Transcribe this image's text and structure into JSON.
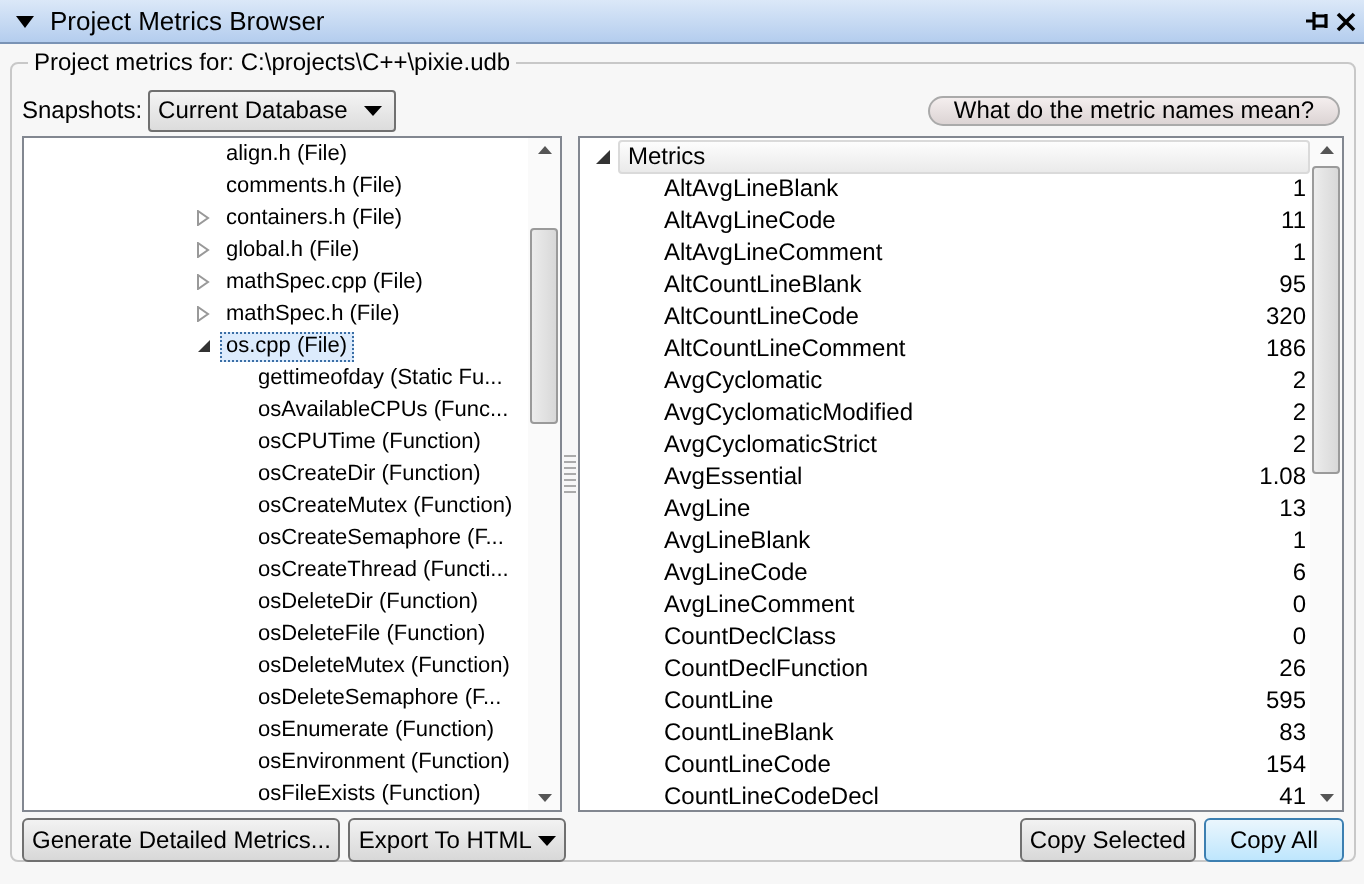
{
  "window": {
    "title": "Project Metrics Browser"
  },
  "group": {
    "label": "Project metrics for: C:\\projects\\C++\\pixie.udb"
  },
  "snapshots": {
    "label": "Snapshots:",
    "value": "Current Database"
  },
  "help_button": "What do the metric names mean?",
  "tree": [
    {
      "label": "align.h (File)",
      "selected": false
    },
    {
      "label": "comments.h (File)",
      "selected": false
    },
    {
      "label": "containers.h (File)",
      "selected": false,
      "expanded": false
    },
    {
      "label": "global.h (File)",
      "selected": false,
      "expanded": false
    },
    {
      "label": "mathSpec.cpp (File)",
      "selected": false,
      "expanded": false
    },
    {
      "label": "mathSpec.h (File)",
      "selected": false,
      "expanded": false
    },
    {
      "label": "os.cpp (File)",
      "selected": true,
      "expanded": true,
      "children": [
        {
          "label": "gettimeofday (Static Fu...",
          "selected": false
        },
        {
          "label": "osAvailableCPUs (Func...",
          "selected": false
        },
        {
          "label": "osCPUTime (Function)",
          "selected": false
        },
        {
          "label": "osCreateDir (Function)",
          "selected": false
        },
        {
          "label": "osCreateMutex (Function)",
          "selected": false
        },
        {
          "label": "osCreateSemaphore (F...",
          "selected": false
        },
        {
          "label": "osCreateThread (Functi...",
          "selected": false
        },
        {
          "label": "osDeleteDir (Function)",
          "selected": false
        },
        {
          "label": "osDeleteFile (Function)",
          "selected": false
        },
        {
          "label": "osDeleteMutex (Function)",
          "selected": false
        },
        {
          "label": "osDeleteSemaphore (F...",
          "selected": false
        },
        {
          "label": "osEnumerate (Function)",
          "selected": false
        },
        {
          "label": "osEnvironment (Function)",
          "selected": false
        },
        {
          "label": "osFileExists (Function)",
          "selected": false
        }
      ]
    }
  ],
  "metrics": {
    "header": "Metrics",
    "expanded": true,
    "rows": [
      {
        "name": "AltAvgLineBlank",
        "value": "1"
      },
      {
        "name": "AltAvgLineCode",
        "value": "11"
      },
      {
        "name": "AltAvgLineComment",
        "value": "1"
      },
      {
        "name": "AltCountLineBlank",
        "value": "95"
      },
      {
        "name": "AltCountLineCode",
        "value": "320"
      },
      {
        "name": "AltCountLineComment",
        "value": "186"
      },
      {
        "name": "AvgCyclomatic",
        "value": "2"
      },
      {
        "name": "AvgCyclomaticModified",
        "value": "2"
      },
      {
        "name": "AvgCyclomaticStrict",
        "value": "2"
      },
      {
        "name": "AvgEssential",
        "value": "1.08"
      },
      {
        "name": "AvgLine",
        "value": "13"
      },
      {
        "name": "AvgLineBlank",
        "value": "1"
      },
      {
        "name": "AvgLineCode",
        "value": "6"
      },
      {
        "name": "AvgLineComment",
        "value": "0"
      },
      {
        "name": "CountDeclClass",
        "value": "0"
      },
      {
        "name": "CountDeclFunction",
        "value": "26"
      },
      {
        "name": "CountLine",
        "value": "595"
      },
      {
        "name": "CountLineBlank",
        "value": "83"
      },
      {
        "name": "CountLineCode",
        "value": "154"
      },
      {
        "name": "CountLineCodeDecl",
        "value": "41"
      }
    ]
  },
  "left_buttons": [
    {
      "label": "Generate Detailed Metrics...",
      "kind": "plain"
    },
    {
      "label": "Export To HTML",
      "kind": "menu"
    }
  ],
  "right_buttons": [
    {
      "label": "Copy Selected",
      "kind": "plain"
    },
    {
      "label": "Copy All",
      "kind": "default"
    }
  ]
}
